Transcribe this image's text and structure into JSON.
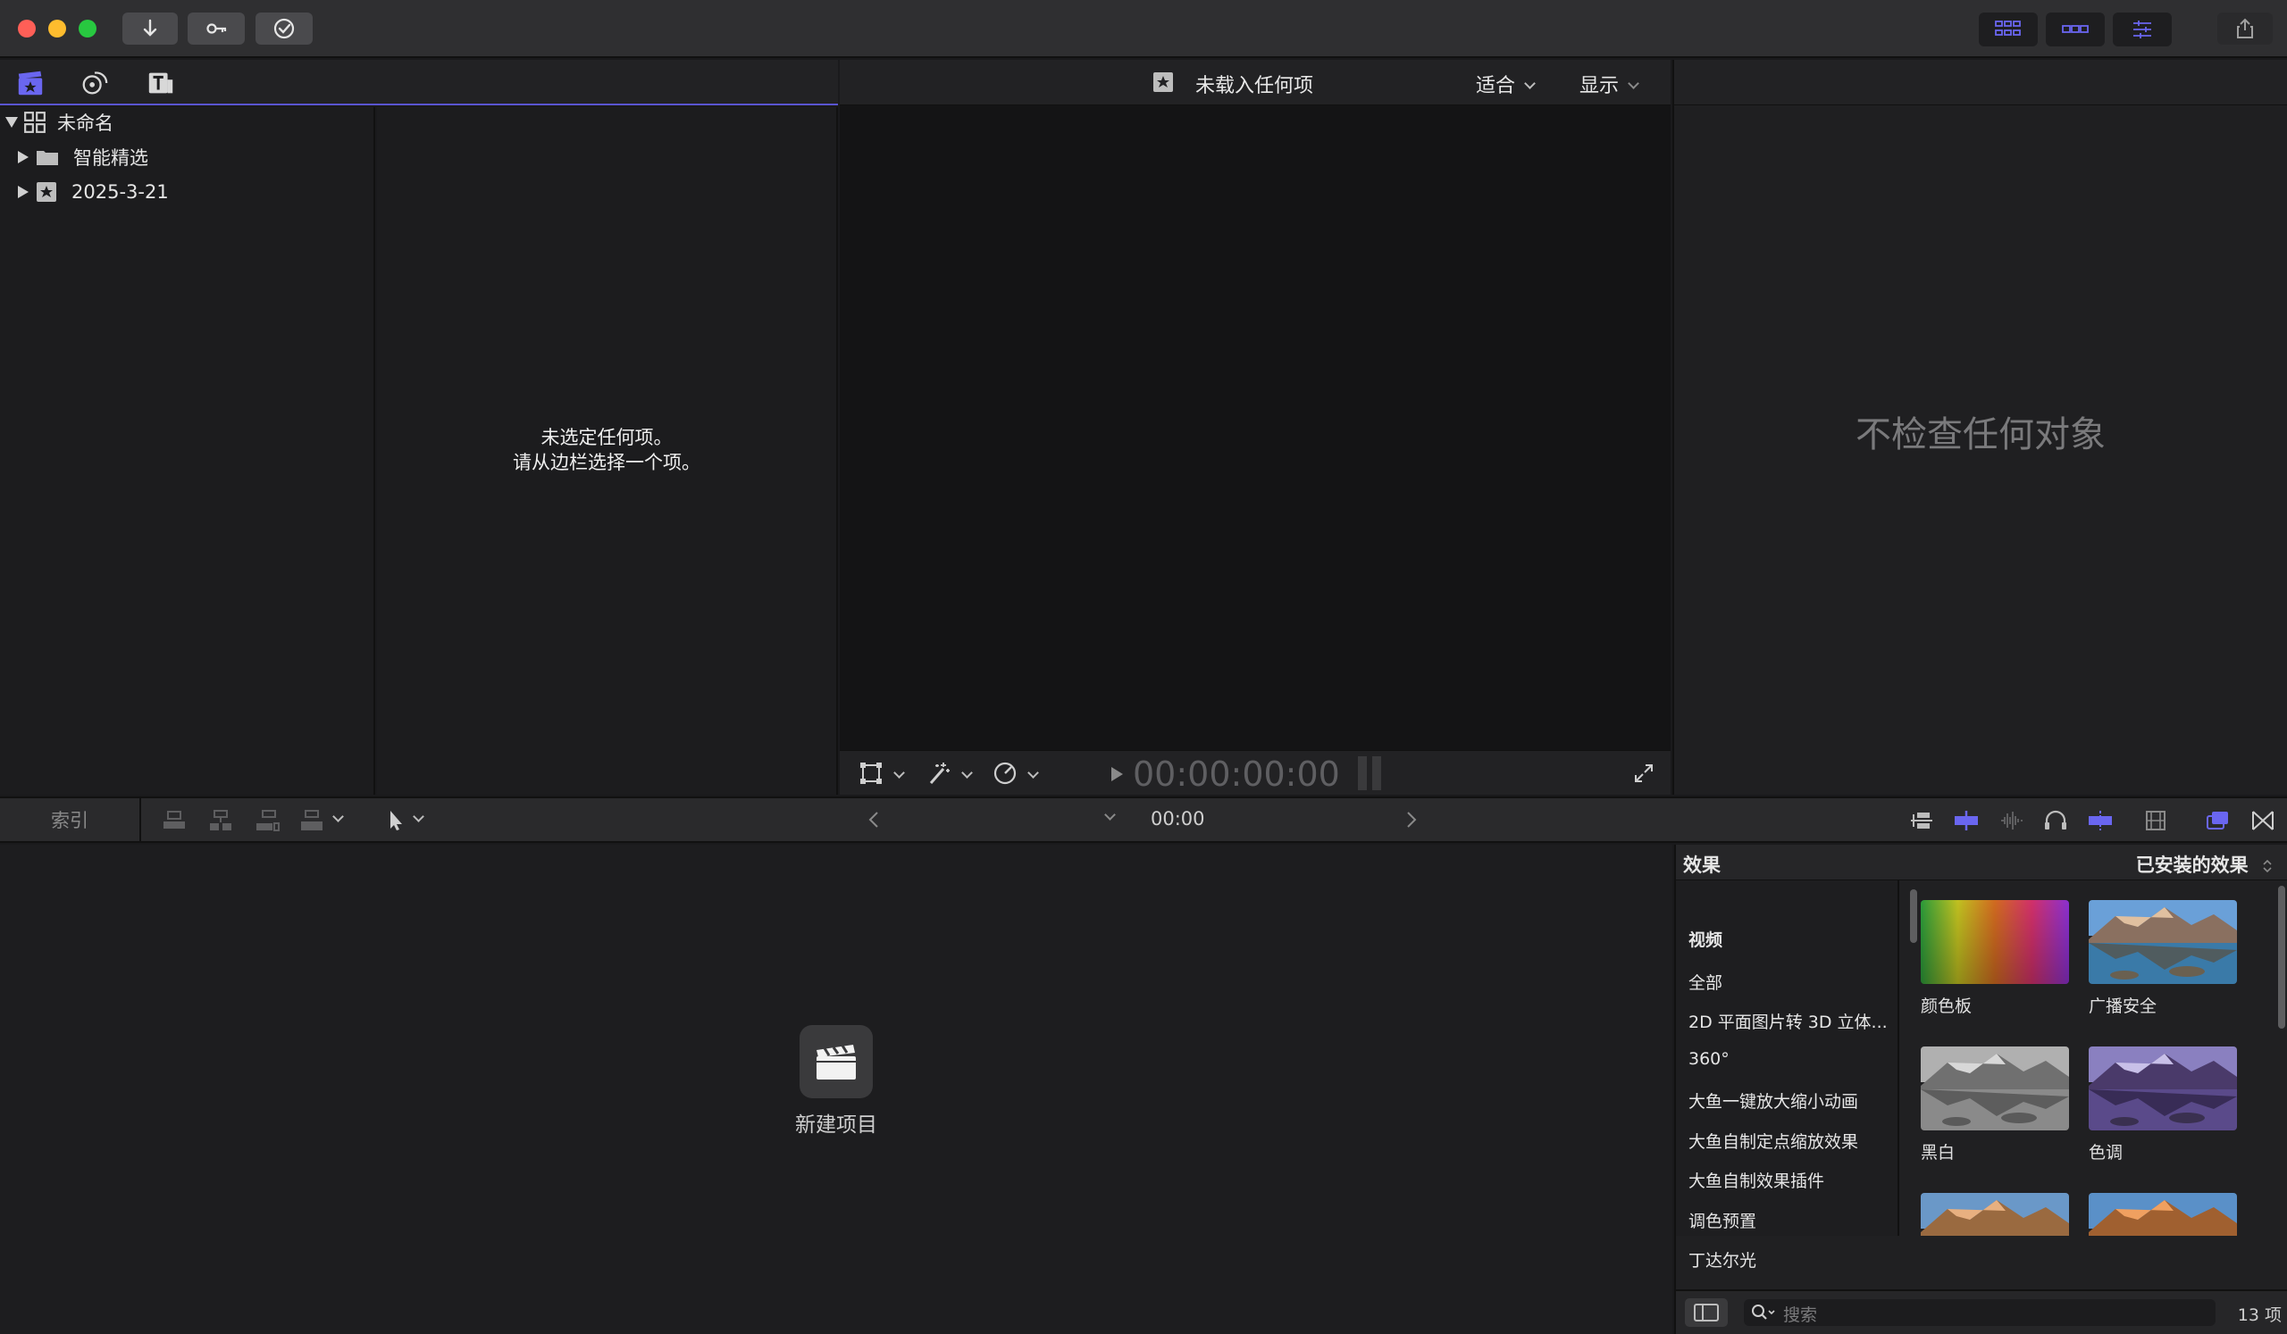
{
  "window": {
    "traffic_lights": {
      "close": "#ff5f57",
      "minimize": "#febc2e",
      "maximize": "#28c840"
    },
    "toolbar_icons": [
      "import-icon",
      "keyword-icon",
      "background-tasks-icon"
    ],
    "workspace_icons": [
      "browser-toggle-icon",
      "timeline-toggle-icon",
      "inspector-toggle-icon"
    ],
    "share_icon": "share-icon",
    "accent": "#5a55d0"
  },
  "library": {
    "tabs": [
      "libraries-icon",
      "photos-audio-icon",
      "titles-generators-icon"
    ],
    "root": "未命名",
    "items": [
      "智能精选",
      "2025-3-21"
    ]
  },
  "browser": {
    "empty_line1": "未选定任何项。",
    "empty_line2": "请从边栏选择一个项。"
  },
  "viewer": {
    "title": "未载入任何项",
    "fit_label": "适合",
    "view_label": "显示",
    "timecode": "00:00:00:00"
  },
  "inspector": {
    "empty_text": "不检查任何对象"
  },
  "timeline": {
    "index_label": "索引",
    "timecode": "00:00",
    "new_project_label": "新建项目"
  },
  "effects": {
    "title": "效果",
    "filter_label": "已安装的效果",
    "categories": [
      "视频",
      "全部",
      "2D 平面图片转 3D 立体...",
      "360°",
      "大鱼一键放大缩小动画",
      "大鱼自制定点缩放效果",
      "大鱼自制效果插件",
      "调色预置",
      "丁达尔光"
    ],
    "items": [
      {
        "label": "颜色板"
      },
      {
        "label": "广播安全"
      },
      {
        "label": "黑白"
      },
      {
        "label": "色调"
      },
      {
        "label": ""
      },
      {
        "label": ""
      }
    ],
    "search_placeholder": "搜索",
    "count_label": "13 项"
  }
}
